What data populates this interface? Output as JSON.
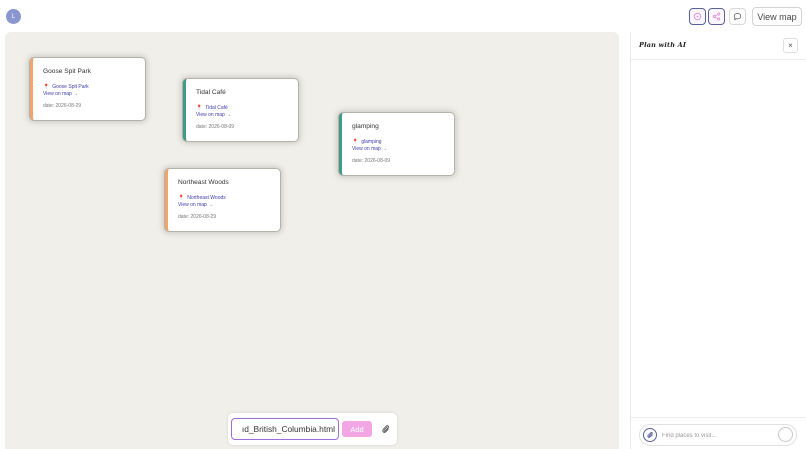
{
  "topbar": {
    "avatar_initial": "L",
    "view_map_label": "View map"
  },
  "cards": [
    {
      "title": "Goose Spit Park",
      "location": "Goose Spit Park",
      "link": "View on map →",
      "date": "date: 2026-08-29"
    },
    {
      "title": "Tidal Café",
      "location": "Tidal Café",
      "link": "View on map →",
      "date": "date: 2026-08-09"
    },
    {
      "title": "glamping",
      "location": "glamping",
      "link": "View on map →",
      "date": "date: 2026-08-09"
    },
    {
      "title": "Northeast Woods",
      "location": "Northeast Woods",
      "link": "View on map →",
      "date": "date: 2026-08-29"
    }
  ],
  "addbar": {
    "input_value": "ıd_British_Columbia.html",
    "add_label": "Add"
  },
  "panel": {
    "title": "Plan with AI",
    "close_symbol": "×",
    "input_placeholder": "Find places to visit..."
  },
  "colors": {
    "canvas": "#f1efe9",
    "accent_orange": "#f2a56b",
    "accent_teal": "#3f9a8a",
    "link": "#3d3daa",
    "add_button": "#f2a7e4",
    "avatar": "#8a96cf"
  },
  "icons": [
    "compass-icon",
    "share-icon",
    "comment-icon",
    "paperclip-icon",
    "map-pin-icon",
    "close-icon",
    "send-icon"
  ]
}
